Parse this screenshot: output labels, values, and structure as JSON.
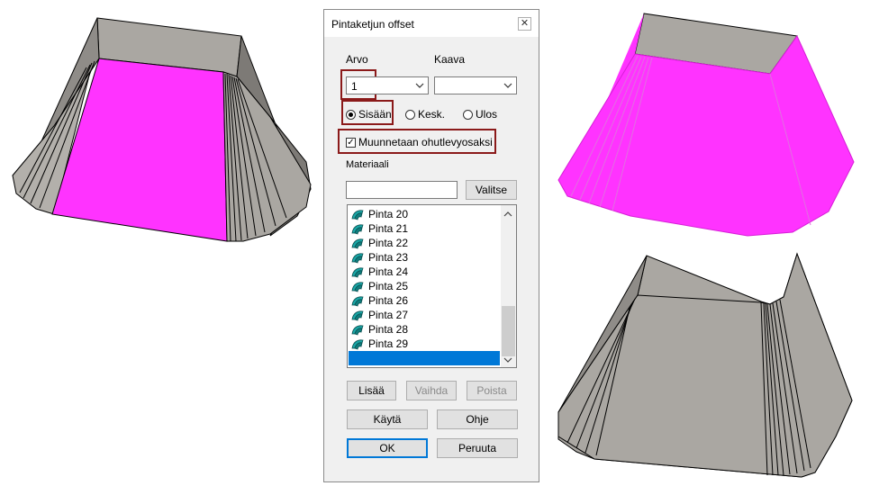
{
  "dialog": {
    "title": "Pintaketjun offset",
    "close_glyph": "✕",
    "arvo_label": "Arvo",
    "kaava_label": "Kaava",
    "arvo_value": "1",
    "kaava_value": "",
    "radios": [
      {
        "label": "Sisään",
        "selected": true
      },
      {
        "label": "Kesk.",
        "selected": false
      },
      {
        "label": "Ulos",
        "selected": false
      }
    ],
    "checkbox": {
      "label": "Muunnetaan ohutlevyosaksi",
      "checked": true,
      "glyph": "✓"
    },
    "materiaali_label": "Materiaali",
    "materiaali_value": "",
    "valitse_label": "Valitse",
    "list_items": [
      "Pinta 20",
      "Pinta 21",
      "Pinta 22",
      "Pinta 23",
      "Pinta 24",
      "Pinta 25",
      "Pinta 26",
      "Pinta 27",
      "Pinta 28",
      "Pinta 29",
      ""
    ],
    "list_item_icon": "surface-icon",
    "buttons": {
      "lisaa": "Lisää",
      "vaihda": "Vaihda",
      "poista": "Poista",
      "kayta": "Käytä",
      "ohje": "Ohje",
      "ok": "OK",
      "peruuta": "Peruuta"
    }
  },
  "colors": {
    "highlight_border": "#8b1a1a",
    "surface_magenta": "#ff33ff",
    "surface_grey": "#aaa7a2",
    "selection": "#0078d7"
  }
}
